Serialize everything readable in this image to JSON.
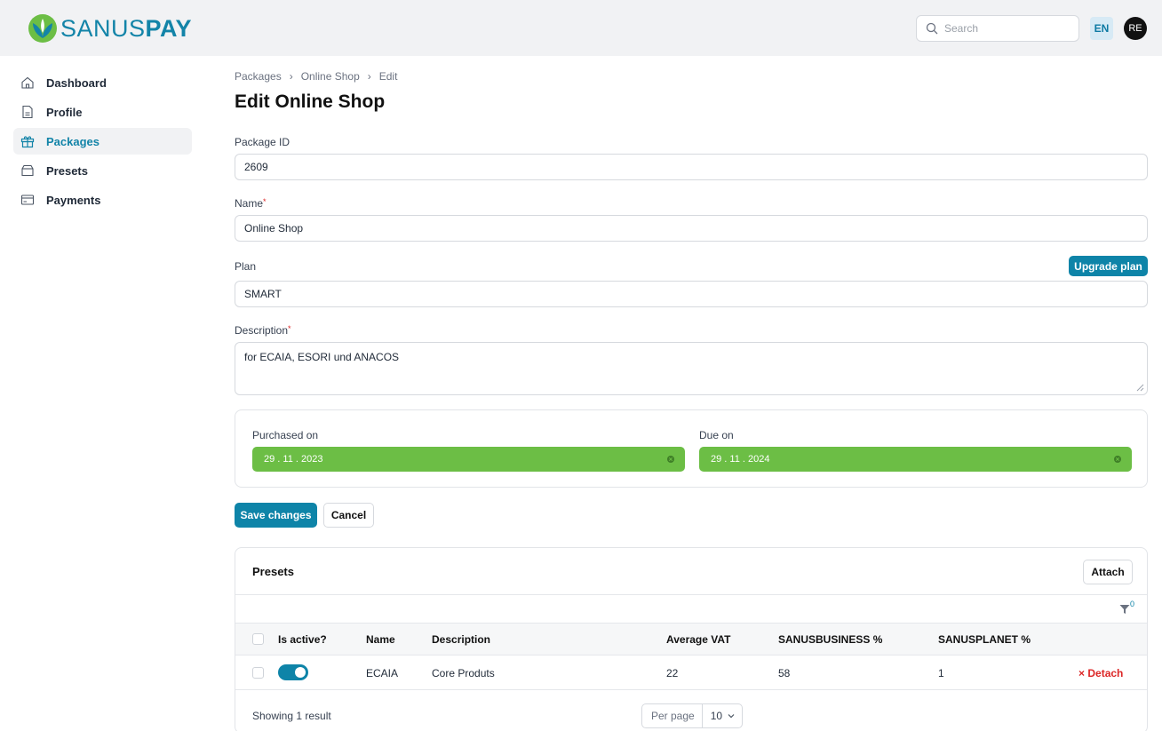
{
  "brand": {
    "name_part1": "SANUS",
    "name_part2": "PAY"
  },
  "header": {
    "search_placeholder": "Search",
    "language": "EN",
    "avatar_initials": "RE"
  },
  "sidebar": {
    "items": [
      {
        "label": "Dashboard",
        "icon": "home-icon"
      },
      {
        "label": "Profile",
        "icon": "document-icon"
      },
      {
        "label": "Packages",
        "icon": "gift-icon",
        "active": true
      },
      {
        "label": "Presets",
        "icon": "box-icon"
      },
      {
        "label": "Payments",
        "icon": "card-icon"
      }
    ]
  },
  "breadcrumb": [
    "Packages",
    "Online Shop",
    "Edit"
  ],
  "page_title": "Edit Online Shop",
  "form": {
    "package_id": {
      "label": "Package ID",
      "value": "2609"
    },
    "name": {
      "label": "Name",
      "value": "Online Shop",
      "required": "*"
    },
    "plan": {
      "label": "Plan",
      "value": "SMART",
      "upgrade_label": "Upgrade plan"
    },
    "description": {
      "label": "Description",
      "value": "for ECAIA, ESORI und ANACOS",
      "required": "*"
    },
    "purchased_on": {
      "label": "Purchased on",
      "value": "29 . 11 . 2023"
    },
    "due_on": {
      "label": "Due on",
      "value": "29 . 11 . 2024"
    },
    "save_label": "Save changes",
    "cancel_label": "Cancel"
  },
  "presets": {
    "title": "Presets",
    "attach_label": "Attach",
    "filter_count": "0",
    "columns": [
      "Is active?",
      "Name",
      "Description",
      "Average VAT",
      "SANUSBUSINESS %",
      "SANUSPLANET %"
    ],
    "rows": [
      {
        "active": true,
        "name": "ECAIA",
        "description": "Core Produts",
        "average_vat": "22",
        "sanusbusiness": "58",
        "sanusplanet": "1",
        "action": "Detach"
      }
    ],
    "showing": "Showing 1 result",
    "per_page_label": "Per page",
    "per_page_value": "10"
  },
  "colors": {
    "brand": "#1384a8",
    "primary_button": "#0e84a8",
    "date_green": "#6cbe45",
    "danger": "#dc2626"
  }
}
